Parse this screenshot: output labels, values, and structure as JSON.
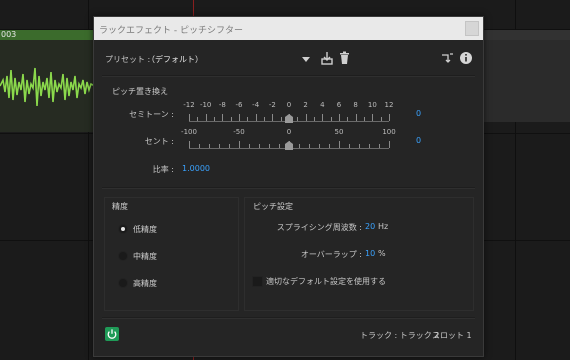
{
  "background": {
    "clip_label": "003"
  },
  "dialog": {
    "title": "ラックエフェクト - ピッチシフター",
    "preset_label": "プリセット :",
    "preset_value": "（デフォルト）",
    "pitch_section": {
      "title": "ピッチ置き換え",
      "semitone": {
        "label": "セミトーン :",
        "value": "0",
        "tick_labels": [
          "-12",
          "-10",
          "-8",
          "-6",
          "-4",
          "-2",
          "0",
          "2",
          "4",
          "6",
          "8",
          "10",
          "12"
        ],
        "min": -12,
        "max": 12,
        "current": 0
      },
      "cents": {
        "label": "セント :",
        "value": "0",
        "tick_labels": [
          "-100",
          "-50",
          "0",
          "50",
          "100"
        ],
        "min": -100,
        "max": 100,
        "current": 0
      },
      "ratio": {
        "label": "比率 :",
        "value": "1.0000"
      }
    },
    "precision_section": {
      "title": "精度",
      "options": [
        {
          "label": "低精度",
          "selected": true
        },
        {
          "label": "中精度",
          "selected": false
        },
        {
          "label": "高精度",
          "selected": false
        }
      ]
    },
    "pitch_settings": {
      "title": "ピッチ設定",
      "splicing": {
        "label": "スプライシング周波数 :",
        "value": "20",
        "unit": "Hz"
      },
      "overlap": {
        "label": "オーバーラップ :",
        "value": "10",
        "unit": "%"
      },
      "default_checkbox": {
        "label": "適切なデフォルト設定を使用する",
        "checked": false
      }
    },
    "footer": {
      "track": "トラック : トラック 2",
      "slot": "スロット 1"
    }
  },
  "colors": {
    "accent_value": "#3aa3ff",
    "power_on": "#1f9a57",
    "waveform": "#8bd94c",
    "playhead": "#8a1f1f"
  }
}
